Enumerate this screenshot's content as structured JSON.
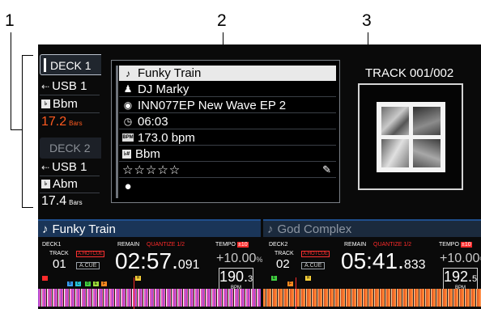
{
  "callouts": [
    "1",
    "2",
    "3"
  ],
  "left_panel": {
    "deck1_tab": "DECK 1",
    "deck1_source": "USB 1",
    "deck1_key": "Bbm",
    "deck1_bars_value": "17.2",
    "deck1_bars_unit": "Bars",
    "deck2_tab": "DECK 2",
    "deck2_source": "USB 1",
    "deck2_key": "Abm",
    "deck2_bars_value": "17.4",
    "deck2_bars_unit": "Bars"
  },
  "track_info": {
    "title": "Funky Train",
    "artist": "DJ Marky",
    "album": "INN077EP New Wave EP 2",
    "duration": "06:03",
    "bpm": "173.0 bpm",
    "key": "Bbm",
    "rating": "☆☆☆☆☆",
    "bpm_icon_text": "BPM",
    "key_icon_text": "♭#"
  },
  "artwork": {
    "track_counter": "TRACK 001/002"
  },
  "deck_strip_1": {
    "title": "Funky Train",
    "deck_label": "DECK1",
    "remain_label": "REMAIN",
    "quantize_label": "QUANTIZE 1/2",
    "tempo_label": "TEMPO",
    "tempo_range": "±10",
    "track_label": "TRACK",
    "track_number": "01",
    "hotcue_label": "A.HOTCUE",
    "acue_label": "A.CUE",
    "time_main": "02:57.",
    "time_ms": "091",
    "tempo_value": "+10.00",
    "tempo_unit": "%",
    "bpm_main": "190.",
    "bpm_dec": "3",
    "bpm_label": "BPM",
    "cue_letters": [
      "B",
      "C",
      "D",
      "E",
      "F",
      "H"
    ]
  },
  "deck_strip_2": {
    "title": "God Complex",
    "deck_label": "DECK2",
    "remain_label": "REMAIN",
    "quantize_label": "QUANTIZE 1/2",
    "tempo_label": "TEMPO",
    "tempo_range": "±10",
    "track_label": "TRACK",
    "track_number": "02",
    "hotcue_label": "A.HOTCUE",
    "acue_label": "A.CUE",
    "time_main": "05:41.",
    "time_ms": "833",
    "tempo_value": "+10.00",
    "tempo_unit": "%",
    "bpm_main": "192.",
    "bpm_dec": "5",
    "bpm_label": "BPM",
    "cue_letters": [
      "E",
      "F",
      "H"
    ]
  },
  "colors": {
    "accent_red": "#ff2b2b",
    "strip_blue": "#1f4e8c",
    "bars_orange": "#ff5a1f",
    "text_white": "#ffffff"
  }
}
